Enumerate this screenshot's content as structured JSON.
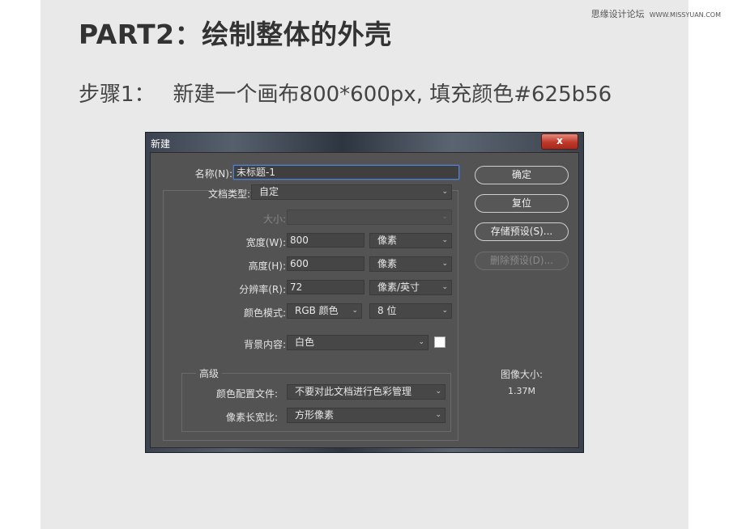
{
  "watermark": {
    "site_cn": "思缘设计论坛",
    "site_url": "WWW.MISSYUAN.COM"
  },
  "heading": {
    "title": "PART2：绘制整体的外壳",
    "step_label": "步骤1：",
    "step_text": "新建一个画布800*600px, 填充颜色#625b56"
  },
  "dialog": {
    "title": "新建",
    "close_glyph": "x",
    "fields": {
      "name": {
        "label": "名称(N):",
        "value": "未标题-1"
      },
      "doc_type": {
        "label": "文档类型:",
        "value": "自定"
      },
      "size": {
        "label": "大小:",
        "value": ""
      },
      "width": {
        "label": "宽度(W):",
        "value": "800",
        "unit": "像素"
      },
      "height": {
        "label": "高度(H):",
        "value": "600",
        "unit": "像素"
      },
      "resolution": {
        "label": "分辨率(R):",
        "value": "72",
        "unit": "像素/英寸"
      },
      "color_mode": {
        "label": "颜色模式:",
        "value": "RGB 颜色",
        "depth": "8 位"
      },
      "background": {
        "label": "背景内容:",
        "value": "白色",
        "swatch_color": "#ffffff"
      }
    },
    "advanced": {
      "legend": "高级",
      "color_profile": {
        "label": "颜色配置文件:",
        "value": "不要对此文档进行色彩管理"
      },
      "pixel_aspect": {
        "label": "像素长宽比:",
        "value": "方形像素"
      }
    },
    "buttons": {
      "ok": "确定",
      "reset": "复位",
      "save_preset": "存储预设(S)...",
      "delete_preset": "删除预设(D)..."
    },
    "image_size": {
      "label": "图像大小:",
      "value": "1.37M"
    }
  },
  "colors": {
    "panel_bg": "#e9e9e9",
    "dialog_bg": "#535353",
    "close_red": "#c0392b",
    "focus_blue": "#4f7fd0"
  },
  "icons": {
    "dropdown": "chevron-down-icon",
    "close": "close-icon"
  }
}
